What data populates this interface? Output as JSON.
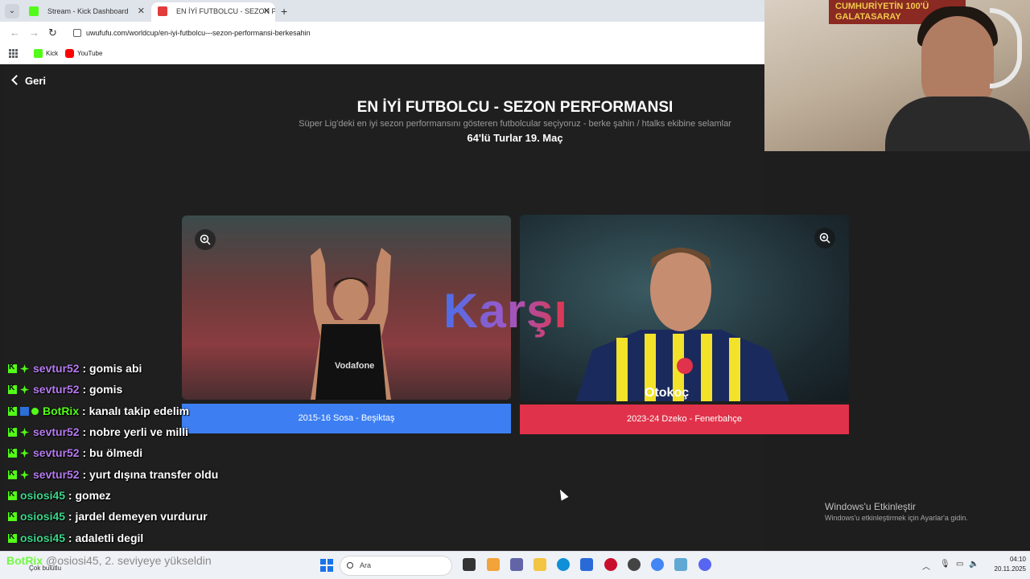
{
  "browser": {
    "tabs": [
      {
        "label": "Stream - Kick Dashboard",
        "close": "✕"
      },
      {
        "label": "EN İYİ FUTBOLCU - SEZON PERF",
        "close": "✕"
      }
    ],
    "new_tab": "+",
    "tab_menu": "⌄",
    "url": "uwufufu.com/worldcup/en-iyi-futbolcu---sezon-performansi-berkesahin",
    "bookmarks": [
      "Kick",
      "YouTube"
    ]
  },
  "page": {
    "back_label": "Geri",
    "title": "EN İYİ FUTBOLCU - SEZON PERFORMANSI",
    "subtitle": "Süper Lig'deki en iyi sezon performansını gösteren futbolcular seçiyoruz - berke şahin / htalks ekibine selamlar",
    "round": "64'lü Turlar 19. Maç",
    "versus": "Karşı",
    "choices": [
      {
        "label": "2015-16 Sosa - Beşiktaş",
        "color": "#3d7ff2",
        "shirt_text": "Vodafone"
      },
      {
        "label": "2023-24 Dzeko - Fenerbahçe",
        "color": "#e0324a",
        "shirt_text": "Otokoç"
      }
    ]
  },
  "chat": [
    {
      "user": "sevtur52",
      "message": ": gomis abi",
      "color": "purple",
      "badges": [
        "kick",
        "sub"
      ]
    },
    {
      "user": "sevtur52",
      "message": ": gomis",
      "color": "purple",
      "badges": [
        "kick",
        "sub"
      ]
    },
    {
      "user": "BotRix",
      "message": ": kanalı takip edelim",
      "color": "green",
      "badges": [
        "kick",
        "bot",
        "verified"
      ]
    },
    {
      "user": "sevtur52",
      "message": ": nobre yerli ve milli",
      "color": "purple",
      "badges": [
        "kick",
        "sub"
      ]
    },
    {
      "user": "sevtur52",
      "message": ": bu ölmedi",
      "color": "purple",
      "badges": [
        "kick",
        "sub"
      ]
    },
    {
      "user": "sevtur52",
      "message": ": yurt dışına transfer oldu",
      "color": "purple",
      "badges": [
        "kick",
        "sub"
      ]
    },
    {
      "user": "osiosi45",
      "message": ": gomez",
      "color": "teal",
      "badges": [
        "kick"
      ]
    },
    {
      "user": "osiosi45",
      "message": ": jardel demeyen vurdurur",
      "color": "teal",
      "badges": [
        "kick"
      ]
    },
    {
      "user": "osiosi45",
      "message": ": adaletli degil",
      "color": "teal",
      "badges": [
        "kick"
      ]
    }
  ],
  "chat_partial": {
    "user": "BotRix",
    "message": "@osiosi45, 2. seviyeye yükseldin"
  },
  "webcam": {
    "banner": "CUMHURİYETİN 100'Ü GALATASARAY"
  },
  "windows": {
    "activate_title": "Windows'u Etkinleştir",
    "activate_sub": "Windows'u etkinleştirmek için Ayarlar'a gidin."
  },
  "taskbar": {
    "weather": "Çok bulutlu",
    "search_placeholder": "Ara",
    "time": "04:10",
    "date": "20.11.2025"
  }
}
